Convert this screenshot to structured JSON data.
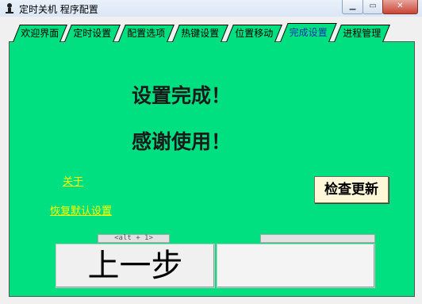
{
  "window": {
    "title": "定时关机 程序配置"
  },
  "tabs": [
    {
      "label": "欢迎界面"
    },
    {
      "label": "定时设置"
    },
    {
      "label": "配置选项"
    },
    {
      "label": "热键设置"
    },
    {
      "label": "位置移动"
    },
    {
      "label": "完成设置",
      "active": true
    },
    {
      "label": "进程管理"
    }
  ],
  "main": {
    "headline": "设置完成！",
    "thanks": "感谢使用！",
    "about_link": "关于",
    "reset_link": "恢复默认设置",
    "check_update_button": "检查更新"
  },
  "nav": {
    "prev_hint": "<alt + 1>",
    "prev_button": "上一步",
    "next_hint": "",
    "next_button": ""
  },
  "icons": {
    "app": "app-icon",
    "minimize": "minimize-icon",
    "maximize": "maximize-icon",
    "close": "close-icon"
  },
  "colors": {
    "panel": "#00e080",
    "link": "#ffff00",
    "active_tab_text": "#1233b0",
    "check_button_bg": "#fff8d8"
  }
}
